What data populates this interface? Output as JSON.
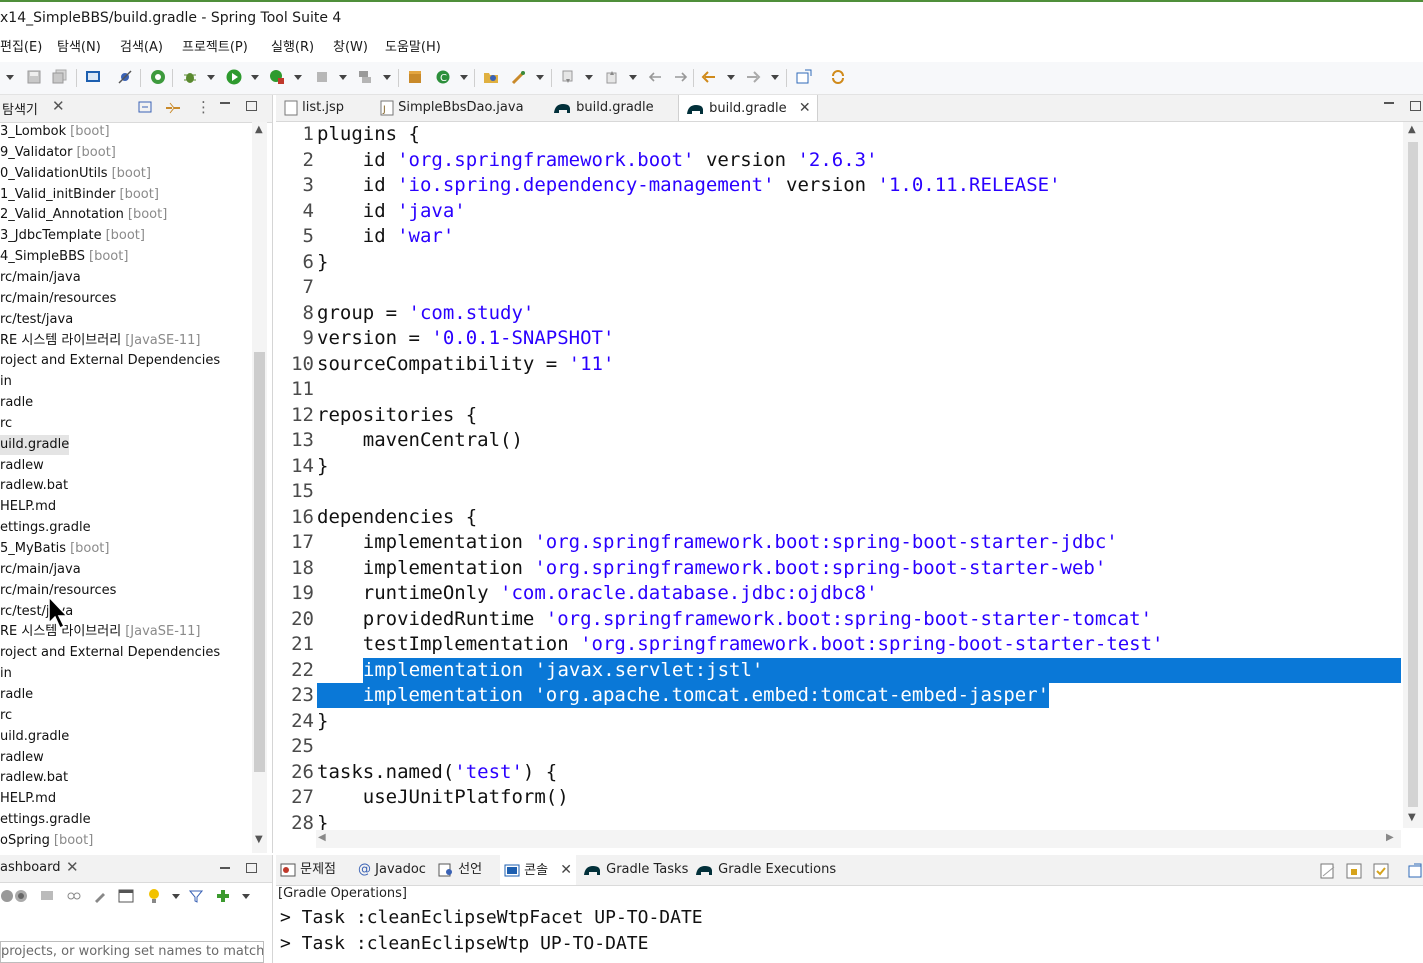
{
  "window": {
    "title": "x14_SimpleBBS/build.gradle - Spring Tool Suite 4"
  },
  "menu": [
    "편집(E)",
    "탐색(N)",
    "검색(A)",
    "프로젝트(P)",
    "실행(R)",
    "창(W)",
    "도움말(H)"
  ],
  "explorer": {
    "tab_label": "탐색기",
    "items": [
      {
        "name": "3_Lombok",
        "decoration": "[boot]"
      },
      {
        "name": "9_Validator",
        "decoration": "[boot]"
      },
      {
        "name": "0_ValidationUtils",
        "decoration": "[boot]"
      },
      {
        "name": "1_Valid_initBinder",
        "decoration": "[boot]"
      },
      {
        "name": "2_Valid_Annotation",
        "decoration": "[boot]"
      },
      {
        "name": "3_JdbcTemplate",
        "decoration": "[boot]"
      },
      {
        "name": "4_SimpleBBS",
        "decoration": "[boot]"
      },
      {
        "name": "rc/main/java",
        "decoration": ""
      },
      {
        "name": "rc/main/resources",
        "decoration": ""
      },
      {
        "name": "rc/test/java",
        "decoration": ""
      },
      {
        "name": "RE 시스템 라이브러리",
        "decoration": "[JavaSE-11]"
      },
      {
        "name": "roject and External Dependencies",
        "decoration": ""
      },
      {
        "name": "in",
        "decoration": ""
      },
      {
        "name": "radle",
        "decoration": ""
      },
      {
        "name": "rc",
        "decoration": ""
      },
      {
        "name": "uild.gradle",
        "decoration": ""
      },
      {
        "name": "radlew",
        "decoration": ""
      },
      {
        "name": "radlew.bat",
        "decoration": ""
      },
      {
        "name": "HELP.md",
        "decoration": ""
      },
      {
        "name": "ettings.gradle",
        "decoration": ""
      },
      {
        "name": "5_MyBatis",
        "decoration": "[boot]"
      },
      {
        "name": "rc/main/java",
        "decoration": ""
      },
      {
        "name": "rc/main/resources",
        "decoration": ""
      },
      {
        "name": "rc/test/java",
        "decoration": ""
      },
      {
        "name": "RE 시스템 라이브러리",
        "decoration": "[JavaSE-11]"
      },
      {
        "name": "roject and External Dependencies",
        "decoration": ""
      },
      {
        "name": "in",
        "decoration": ""
      },
      {
        "name": "radle",
        "decoration": ""
      },
      {
        "name": "rc",
        "decoration": ""
      },
      {
        "name": "uild.gradle",
        "decoration": ""
      },
      {
        "name": "radlew",
        "decoration": ""
      },
      {
        "name": "radlew.bat",
        "decoration": ""
      },
      {
        "name": "HELP.md",
        "decoration": ""
      },
      {
        "name": "ettings.gradle",
        "decoration": ""
      },
      {
        "name": "oSpring",
        "decoration": "[boot]"
      }
    ]
  },
  "editor": {
    "tabs": [
      "list.jsp",
      "SimpleBbsDao.java",
      "build.gradle",
      "build.gradle"
    ],
    "lines": [
      [
        {
          "t": "plugins {"
        }
      ],
      [
        {
          "t": "    id "
        },
        {
          "t": "'org.springframework.boot'",
          "s": 1
        },
        {
          "t": " version "
        },
        {
          "t": "'2.6.3'",
          "s": 1
        }
      ],
      [
        {
          "t": "    id "
        },
        {
          "t": "'io.spring.dependency-management'",
          "s": 1
        },
        {
          "t": " version "
        },
        {
          "t": "'1.0.11.RELEASE'",
          "s": 1
        }
      ],
      [
        {
          "t": "    id "
        },
        {
          "t": "'java'",
          "s": 1
        }
      ],
      [
        {
          "t": "    id "
        },
        {
          "t": "'war'",
          "s": 1
        }
      ],
      [
        {
          "t": "}"
        }
      ],
      [
        {
          "t": ""
        }
      ],
      [
        {
          "t": "group = "
        },
        {
          "t": "'com.study'",
          "s": 1
        }
      ],
      [
        {
          "t": "version = "
        },
        {
          "t": "'0.0.1-SNAPSHOT'",
          "s": 1
        }
      ],
      [
        {
          "t": "sourceCompatibility = "
        },
        {
          "t": "'11'",
          "s": 1
        }
      ],
      [
        {
          "t": ""
        }
      ],
      [
        {
          "t": "repositories {"
        }
      ],
      [
        {
          "t": "    mavenCentral()"
        }
      ],
      [
        {
          "t": "}"
        }
      ],
      [
        {
          "t": ""
        }
      ],
      [
        {
          "t": "dependencies {"
        }
      ],
      [
        {
          "t": "    implementation "
        },
        {
          "t": "'org.springframework.boot:spring-boot-starter-jdbc'",
          "s": 1
        }
      ],
      [
        {
          "t": "    implementation "
        },
        {
          "t": "'org.springframework.boot:spring-boot-starter-web'",
          "s": 1
        }
      ],
      [
        {
          "t": "    runtimeOnly "
        },
        {
          "t": "'com.oracle.database.jdbc:ojdbc8'",
          "s": 1
        }
      ],
      [
        {
          "t": "    providedRuntime "
        },
        {
          "t": "'org.springframework.boot:spring-boot-starter-tomcat'",
          "s": 1
        }
      ],
      [
        {
          "t": "    testImplementation "
        },
        {
          "t": "'org.springframework.boot:spring-boot-starter-test'",
          "s": 1
        }
      ],
      [
        {
          "t": "    implementation "
        },
        {
          "t": "'javax.servlet:jstl'",
          "s": 1
        }
      ],
      [
        {
          "t": "    implementation "
        },
        {
          "t": "'org.apache.tomcat.embed:tomcat-embed-jasper'",
          "s": 1
        }
      ],
      [
        {
          "t": "}"
        }
      ],
      [
        {
          "t": ""
        }
      ],
      [
        {
          "t": "tasks.named("
        },
        {
          "t": "'test'",
          "s": 1
        },
        {
          "t": ") {"
        }
      ],
      [
        {
          "t": "    useJUnitPlatform()"
        }
      ],
      [
        {
          "t": "}"
        }
      ]
    ],
    "selected_lines": [
      22,
      23
    ]
  },
  "dashboard": {
    "tab_label": "ashboard",
    "filter_placeholder": " projects, or working set names to match"
  },
  "bottom_panel": {
    "tabs": [
      "문제점",
      "Javadoc",
      "선언",
      "콘솔",
      "Gradle Tasks",
      "Gradle Executions"
    ],
    "console_title": "[Gradle Operations]",
    "console_lines": [
      "> Task :cleanEclipseWtpFacet UP-TO-DATE",
      "> Task :cleanEclipseWtp UP-TO-DATE"
    ]
  },
  "colors": {
    "selection": "#0a78d7",
    "string": "#2a00ff",
    "accent_line": "#4f8f3a"
  }
}
